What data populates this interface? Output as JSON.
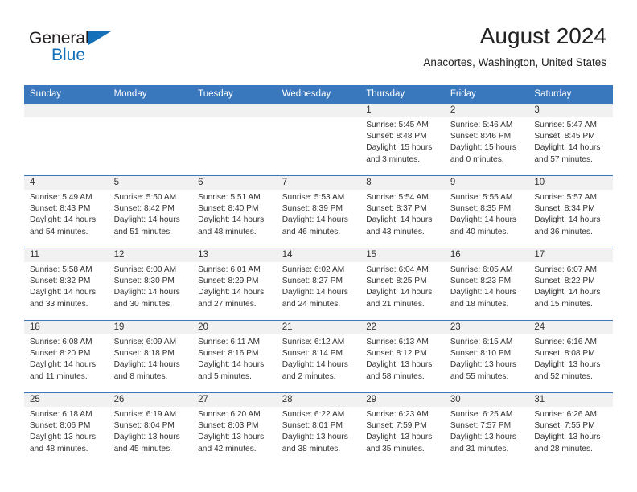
{
  "brand": {
    "name_top": "General",
    "name_bottom": "Blue",
    "triangle_color": "#1470b8",
    "text_color": "#231f20"
  },
  "header": {
    "title": "August 2024",
    "subtitle": "Anacortes, Washington, United States"
  },
  "theme": {
    "header_blue": "#3a78bd",
    "daynum_band": "#f1f1f1",
    "text": "#333333"
  },
  "weekday_headers": [
    "Sunday",
    "Monday",
    "Tuesday",
    "Wednesday",
    "Thursday",
    "Friday",
    "Saturday"
  ],
  "weeks": [
    [
      {
        "day": "",
        "sunrise": "",
        "sunset": "",
        "daylight_line1": "",
        "daylight_line2": "",
        "empty": true
      },
      {
        "day": "",
        "sunrise": "",
        "sunset": "",
        "daylight_line1": "",
        "daylight_line2": "",
        "empty": true
      },
      {
        "day": "",
        "sunrise": "",
        "sunset": "",
        "daylight_line1": "",
        "daylight_line2": "",
        "empty": true
      },
      {
        "day": "",
        "sunrise": "",
        "sunset": "",
        "daylight_line1": "",
        "daylight_line2": "",
        "empty": true
      },
      {
        "day": "1",
        "sunrise": "Sunrise: 5:45 AM",
        "sunset": "Sunset: 8:48 PM",
        "daylight_line1": "Daylight: 15 hours",
        "daylight_line2": "and 3 minutes.",
        "empty": false
      },
      {
        "day": "2",
        "sunrise": "Sunrise: 5:46 AM",
        "sunset": "Sunset: 8:46 PM",
        "daylight_line1": "Daylight: 15 hours",
        "daylight_line2": "and 0 minutes.",
        "empty": false
      },
      {
        "day": "3",
        "sunrise": "Sunrise: 5:47 AM",
        "sunset": "Sunset: 8:45 PM",
        "daylight_line1": "Daylight: 14 hours",
        "daylight_line2": "and 57 minutes.",
        "empty": false
      }
    ],
    [
      {
        "day": "4",
        "sunrise": "Sunrise: 5:49 AM",
        "sunset": "Sunset: 8:43 PM",
        "daylight_line1": "Daylight: 14 hours",
        "daylight_line2": "and 54 minutes.",
        "empty": false
      },
      {
        "day": "5",
        "sunrise": "Sunrise: 5:50 AM",
        "sunset": "Sunset: 8:42 PM",
        "daylight_line1": "Daylight: 14 hours",
        "daylight_line2": "and 51 minutes.",
        "empty": false
      },
      {
        "day": "6",
        "sunrise": "Sunrise: 5:51 AM",
        "sunset": "Sunset: 8:40 PM",
        "daylight_line1": "Daylight: 14 hours",
        "daylight_line2": "and 48 minutes.",
        "empty": false
      },
      {
        "day": "7",
        "sunrise": "Sunrise: 5:53 AM",
        "sunset": "Sunset: 8:39 PM",
        "daylight_line1": "Daylight: 14 hours",
        "daylight_line2": "and 46 minutes.",
        "empty": false
      },
      {
        "day": "8",
        "sunrise": "Sunrise: 5:54 AM",
        "sunset": "Sunset: 8:37 PM",
        "daylight_line1": "Daylight: 14 hours",
        "daylight_line2": "and 43 minutes.",
        "empty": false
      },
      {
        "day": "9",
        "sunrise": "Sunrise: 5:55 AM",
        "sunset": "Sunset: 8:35 PM",
        "daylight_line1": "Daylight: 14 hours",
        "daylight_line2": "and 40 minutes.",
        "empty": false
      },
      {
        "day": "10",
        "sunrise": "Sunrise: 5:57 AM",
        "sunset": "Sunset: 8:34 PM",
        "daylight_line1": "Daylight: 14 hours",
        "daylight_line2": "and 36 minutes.",
        "empty": false
      }
    ],
    [
      {
        "day": "11",
        "sunrise": "Sunrise: 5:58 AM",
        "sunset": "Sunset: 8:32 PM",
        "daylight_line1": "Daylight: 14 hours",
        "daylight_line2": "and 33 minutes.",
        "empty": false
      },
      {
        "day": "12",
        "sunrise": "Sunrise: 6:00 AM",
        "sunset": "Sunset: 8:30 PM",
        "daylight_line1": "Daylight: 14 hours",
        "daylight_line2": "and 30 minutes.",
        "empty": false
      },
      {
        "day": "13",
        "sunrise": "Sunrise: 6:01 AM",
        "sunset": "Sunset: 8:29 PM",
        "daylight_line1": "Daylight: 14 hours",
        "daylight_line2": "and 27 minutes.",
        "empty": false
      },
      {
        "day": "14",
        "sunrise": "Sunrise: 6:02 AM",
        "sunset": "Sunset: 8:27 PM",
        "daylight_line1": "Daylight: 14 hours",
        "daylight_line2": "and 24 minutes.",
        "empty": false
      },
      {
        "day": "15",
        "sunrise": "Sunrise: 6:04 AM",
        "sunset": "Sunset: 8:25 PM",
        "daylight_line1": "Daylight: 14 hours",
        "daylight_line2": "and 21 minutes.",
        "empty": false
      },
      {
        "day": "16",
        "sunrise": "Sunrise: 6:05 AM",
        "sunset": "Sunset: 8:23 PM",
        "daylight_line1": "Daylight: 14 hours",
        "daylight_line2": "and 18 minutes.",
        "empty": false
      },
      {
        "day": "17",
        "sunrise": "Sunrise: 6:07 AM",
        "sunset": "Sunset: 8:22 PM",
        "daylight_line1": "Daylight: 14 hours",
        "daylight_line2": "and 15 minutes.",
        "empty": false
      }
    ],
    [
      {
        "day": "18",
        "sunrise": "Sunrise: 6:08 AM",
        "sunset": "Sunset: 8:20 PM",
        "daylight_line1": "Daylight: 14 hours",
        "daylight_line2": "and 11 minutes.",
        "empty": false
      },
      {
        "day": "19",
        "sunrise": "Sunrise: 6:09 AM",
        "sunset": "Sunset: 8:18 PM",
        "daylight_line1": "Daylight: 14 hours",
        "daylight_line2": "and 8 minutes.",
        "empty": false
      },
      {
        "day": "20",
        "sunrise": "Sunrise: 6:11 AM",
        "sunset": "Sunset: 8:16 PM",
        "daylight_line1": "Daylight: 14 hours",
        "daylight_line2": "and 5 minutes.",
        "empty": false
      },
      {
        "day": "21",
        "sunrise": "Sunrise: 6:12 AM",
        "sunset": "Sunset: 8:14 PM",
        "daylight_line1": "Daylight: 14 hours",
        "daylight_line2": "and 2 minutes.",
        "empty": false
      },
      {
        "day": "22",
        "sunrise": "Sunrise: 6:13 AM",
        "sunset": "Sunset: 8:12 PM",
        "daylight_line1": "Daylight: 13 hours",
        "daylight_line2": "and 58 minutes.",
        "empty": false
      },
      {
        "day": "23",
        "sunrise": "Sunrise: 6:15 AM",
        "sunset": "Sunset: 8:10 PM",
        "daylight_line1": "Daylight: 13 hours",
        "daylight_line2": "and 55 minutes.",
        "empty": false
      },
      {
        "day": "24",
        "sunrise": "Sunrise: 6:16 AM",
        "sunset": "Sunset: 8:08 PM",
        "daylight_line1": "Daylight: 13 hours",
        "daylight_line2": "and 52 minutes.",
        "empty": false
      }
    ],
    [
      {
        "day": "25",
        "sunrise": "Sunrise: 6:18 AM",
        "sunset": "Sunset: 8:06 PM",
        "daylight_line1": "Daylight: 13 hours",
        "daylight_line2": "and 48 minutes.",
        "empty": false
      },
      {
        "day": "26",
        "sunrise": "Sunrise: 6:19 AM",
        "sunset": "Sunset: 8:04 PM",
        "daylight_line1": "Daylight: 13 hours",
        "daylight_line2": "and 45 minutes.",
        "empty": false
      },
      {
        "day": "27",
        "sunrise": "Sunrise: 6:20 AM",
        "sunset": "Sunset: 8:03 PM",
        "daylight_line1": "Daylight: 13 hours",
        "daylight_line2": "and 42 minutes.",
        "empty": false
      },
      {
        "day": "28",
        "sunrise": "Sunrise: 6:22 AM",
        "sunset": "Sunset: 8:01 PM",
        "daylight_line1": "Daylight: 13 hours",
        "daylight_line2": "and 38 minutes.",
        "empty": false
      },
      {
        "day": "29",
        "sunrise": "Sunrise: 6:23 AM",
        "sunset": "Sunset: 7:59 PM",
        "daylight_line1": "Daylight: 13 hours",
        "daylight_line2": "and 35 minutes.",
        "empty": false
      },
      {
        "day": "30",
        "sunrise": "Sunrise: 6:25 AM",
        "sunset": "Sunset: 7:57 PM",
        "daylight_line1": "Daylight: 13 hours",
        "daylight_line2": "and 31 minutes.",
        "empty": false
      },
      {
        "day": "31",
        "sunrise": "Sunrise: 6:26 AM",
        "sunset": "Sunset: 7:55 PM",
        "daylight_line1": "Daylight: 13 hours",
        "daylight_line2": "and 28 minutes.",
        "empty": false
      }
    ]
  ]
}
